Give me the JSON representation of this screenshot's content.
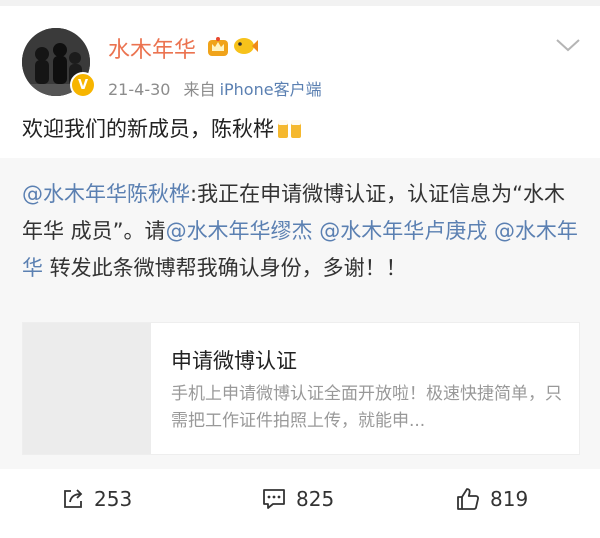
{
  "post": {
    "username": "水木年华",
    "time": "21-4-30",
    "source_prefix": "来自",
    "source_client": "iPhone客户端",
    "text": "欢迎我们的新成员，陈秋桦",
    "verified_badge": "V"
  },
  "repost": {
    "segments": [
      {
        "text": "@水木年华陈秋桦",
        "type": "mention"
      },
      {
        "text": ":我正在申请微博认证，认证信息为“水木年华 成员”。请",
        "type": "text"
      },
      {
        "text": "@水木年华缪杰",
        "type": "mention"
      },
      {
        "text": " ",
        "type": "text"
      },
      {
        "text": "@水木年华卢庚戌",
        "type": "mention"
      },
      {
        "text": " ",
        "type": "text"
      },
      {
        "text": "@水木年华",
        "type": "mention"
      },
      {
        "text": " 转发此条微博帮我确认身份，多谢！！",
        "type": "text"
      }
    ],
    "card": {
      "title": "申请微博认证",
      "description": "手机上申请微博认证全面开放啦！极速快捷简单，只需把工作证件拍照上传，就能申..."
    }
  },
  "actions": {
    "repost_count": "253",
    "comment_count": "825",
    "like_count": "819"
  },
  "colors": {
    "username": "#eb7350",
    "link": "#5b80b2",
    "muted": "#8c8c8c",
    "repost_bg": "#f7f7f7"
  },
  "icons": [
    "avatar",
    "verified-badge-icon",
    "crown-icon",
    "fish-icon",
    "chevron-down-icon",
    "beer-emoji-icon",
    "repost-icon",
    "comment-icon",
    "like-icon"
  ]
}
